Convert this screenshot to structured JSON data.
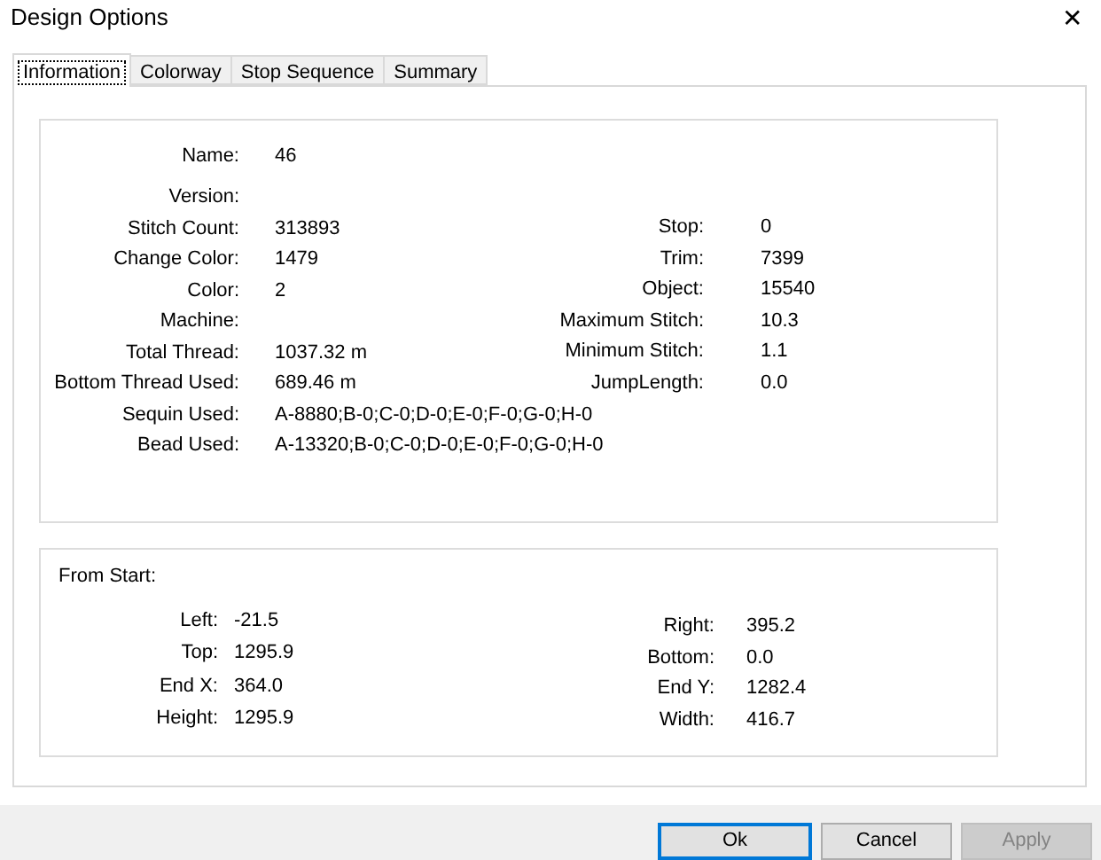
{
  "window": {
    "title": "Design Options",
    "close": "✕"
  },
  "tabs": [
    {
      "label": "Information",
      "selected": true
    },
    {
      "label": "Colorway",
      "selected": false
    },
    {
      "label": "Stop Sequence",
      "selected": false
    },
    {
      "label": "Summary",
      "selected": false
    }
  ],
  "information": {
    "left_fields": [
      {
        "label": "Name:",
        "value": "46"
      },
      {
        "label": "Version:"
      },
      {
        "label": "Stitch Count:",
        "value": "313893"
      },
      {
        "label": "Change Color:",
        "value": "1479"
      },
      {
        "label": "Color:",
        "value": "2"
      },
      {
        "label": "Machine:"
      },
      {
        "label": "Total Thread:",
        "value": "1037.32 m"
      },
      {
        "label": "Bottom Thread Used:",
        "value": "689.46 m"
      },
      {
        "label": "Sequin Used:",
        "value": "A-8880;B-0;C-0;D-0;E-0;F-0;G-0;H-0"
      },
      {
        "label": "Bead Used:",
        "value": "A-13320;B-0;C-0;D-0;E-0;F-0;G-0;H-0"
      }
    ],
    "right_fields": [
      {
        "label": "Stop:",
        "value": "0"
      },
      {
        "label": "Trim:",
        "value": "7399"
      },
      {
        "label": "Object:",
        "value": "15540"
      },
      {
        "label": "Maximum Stitch:",
        "value": "10.3"
      },
      {
        "label": "Minimum Stitch:",
        "value": "1.1"
      },
      {
        "label": "JumpLength:",
        "value": "0.0"
      }
    ]
  },
  "from_start": {
    "title": "From Start:",
    "left_fields": [
      {
        "label": "Left:",
        "value": "-21.5"
      },
      {
        "label": "Top:",
        "value": "1295.9"
      },
      {
        "label": "End X:",
        "value": "364.0"
      },
      {
        "label": "Height:",
        "value": "1295.9"
      }
    ],
    "right_fields": [
      {
        "label": "Right:",
        "value": "395.2"
      },
      {
        "label": "Bottom:",
        "value": "0.0"
      },
      {
        "label": "End Y:",
        "value": "1282.4"
      },
      {
        "label": "Width:",
        "value": "416.7"
      }
    ]
  },
  "buttons": [
    {
      "label": "Ok",
      "default": true,
      "disabled": false
    },
    {
      "label": "Cancel",
      "default": false,
      "disabled": false
    },
    {
      "label": "Apply",
      "default": false,
      "disabled": true
    }
  ]
}
